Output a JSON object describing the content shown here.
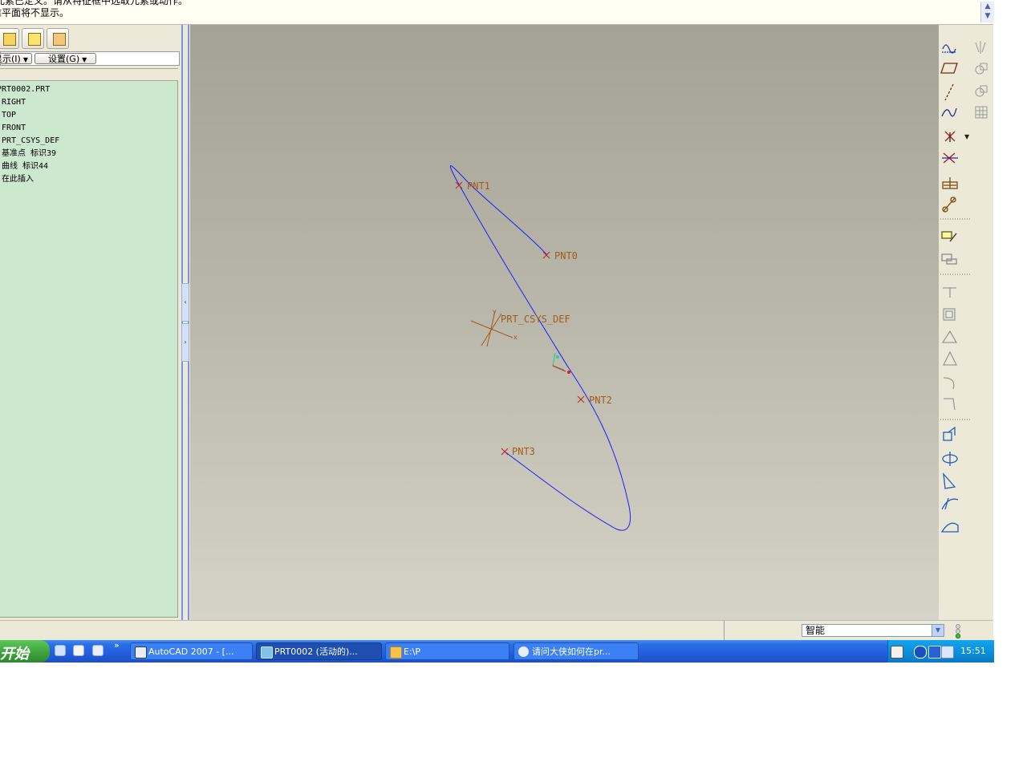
{
  "message_area": {
    "line1": "元素已定义。请从特征框中选取元素或动作。",
    "line2": "准平面将不显示。"
  },
  "left_panel": {
    "show_label": "显示(I)",
    "settings_label": "设置(G)",
    "tree_items": [
      "PRT0002.PRT",
      "RIGHT",
      "TOP",
      "FRONT",
      "PRT_CSYS_DEF",
      "基准点 标识39",
      "曲线 标识44",
      "在此插入"
    ]
  },
  "graphics": {
    "point_labels": [
      "PNT1",
      "PNT0",
      "PRT_CSYS_DEF",
      "PNT2",
      "PNT3"
    ],
    "csys_axis_x": "x",
    "csys_axis_y": "y",
    "curve_color": "#1d1dff",
    "label_color": "#a55a1c"
  },
  "status_bar": {
    "filter_value": "智能"
  },
  "taskbar": {
    "start_label": "开始",
    "quicklaunch_more": "»",
    "tasks": [
      {
        "label": "AutoCAD 2007 - [...",
        "icon": "autocad-icon",
        "active": false
      },
      {
        "label": "PRT0002 (活动的)...",
        "icon": "proe-icon",
        "active": true
      },
      {
        "label": "E:\\P",
        "icon": "folder-icon",
        "active": false
      },
      {
        "label": "请问大侠如何在pr...",
        "icon": "ie-icon",
        "active": false
      }
    ],
    "clock": "15:51"
  }
}
